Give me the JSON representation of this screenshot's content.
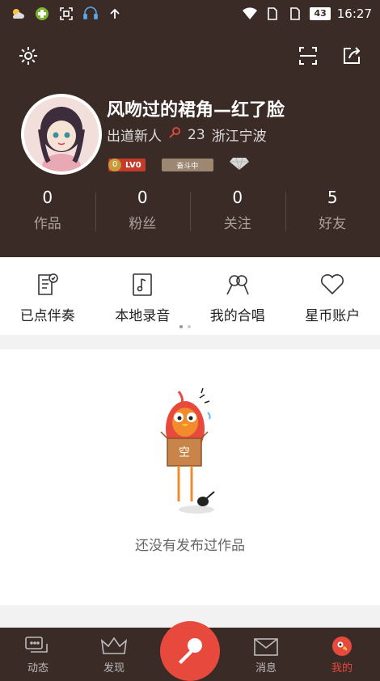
{
  "status_bar": {
    "time": "16:27",
    "battery": "43"
  },
  "profile": {
    "name": "风吻过的裙角—红了脸",
    "title": "出道新人",
    "score": "23",
    "location": "浙江宁波",
    "level_badge": "LV0",
    "level_coin": "0",
    "rank_badge": "奋斗中"
  },
  "stats": [
    {
      "value": "0",
      "label": "作品"
    },
    {
      "value": "0",
      "label": "粉丝"
    },
    {
      "value": "0",
      "label": "关注"
    },
    {
      "value": "5",
      "label": "好友"
    }
  ],
  "menu": [
    {
      "label": "已点伴奏",
      "icon": "song-list-icon"
    },
    {
      "label": "本地录音",
      "icon": "music-note-icon"
    },
    {
      "label": "我的合唱",
      "icon": "chorus-icon"
    },
    {
      "label": "星币账户",
      "icon": "heart-icon"
    }
  ],
  "empty_state": {
    "mascot_label": "空",
    "text": "还没有发布过作品"
  },
  "tabs": [
    {
      "label": "动态",
      "icon": "chat-bubbles-icon",
      "active": false
    },
    {
      "label": "发现",
      "icon": "crown-icon",
      "active": false
    },
    {
      "label": "消息",
      "icon": "envelope-icon",
      "active": false
    },
    {
      "label": "我的",
      "icon": "parrot-icon",
      "active": true
    }
  ],
  "colors": {
    "header_bg": "#3b2b27",
    "accent": "#e8493d"
  }
}
